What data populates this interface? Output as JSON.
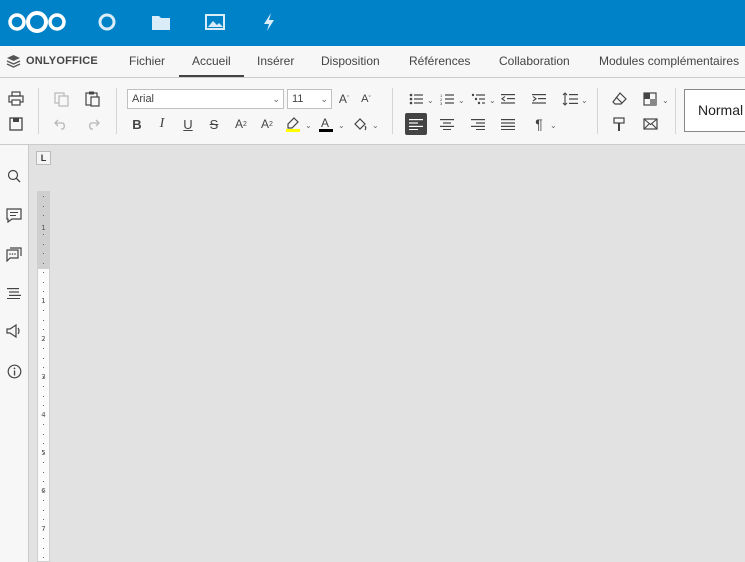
{
  "brand": {
    "name": "ONLYOFFICE"
  },
  "tabs": [
    {
      "label": "Fichier",
      "active": false
    },
    {
      "label": "Accueil",
      "active": true
    },
    {
      "label": "Insérer",
      "active": false
    },
    {
      "label": "Disposition",
      "active": false
    },
    {
      "label": "Références",
      "active": false
    },
    {
      "label": "Collaboration",
      "active": false
    },
    {
      "label": "Modules complémentaires",
      "active": false
    }
  ],
  "font": {
    "name": "Arial",
    "size": "11"
  },
  "style": {
    "current": "Normal"
  },
  "colors": {
    "nav": "#0082c9",
    "highlight": "#ffff00",
    "font_color": "#000000"
  },
  "ruler": {
    "numbers": [
      "1",
      "1",
      "2",
      "3",
      "4",
      "5",
      "6",
      "7"
    ]
  },
  "icons": {
    "nav": [
      "nextcloud-logo-icon",
      "dashboard-icon",
      "files-icon",
      "photos-icon",
      "activity-icon"
    ],
    "left": [
      "search-icon",
      "comments-icon",
      "chat-icon",
      "navigation-icon",
      "feedback-icon",
      "about-icon"
    ]
  }
}
